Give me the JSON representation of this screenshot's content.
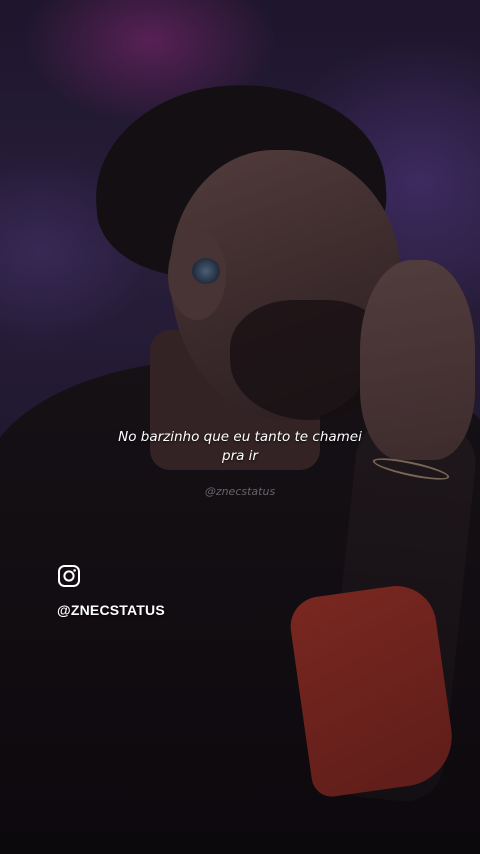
{
  "lyric": {
    "line1": "No barzinho que eu tanto te chamei",
    "line2": "pra ir"
  },
  "watermark": "@znecstatus",
  "profile": {
    "icon": "instagram-icon",
    "handle": "@ZNECSTATUS"
  },
  "colors": {
    "accent_red": "#b53a2a",
    "background_purple": "#3a2c55"
  }
}
